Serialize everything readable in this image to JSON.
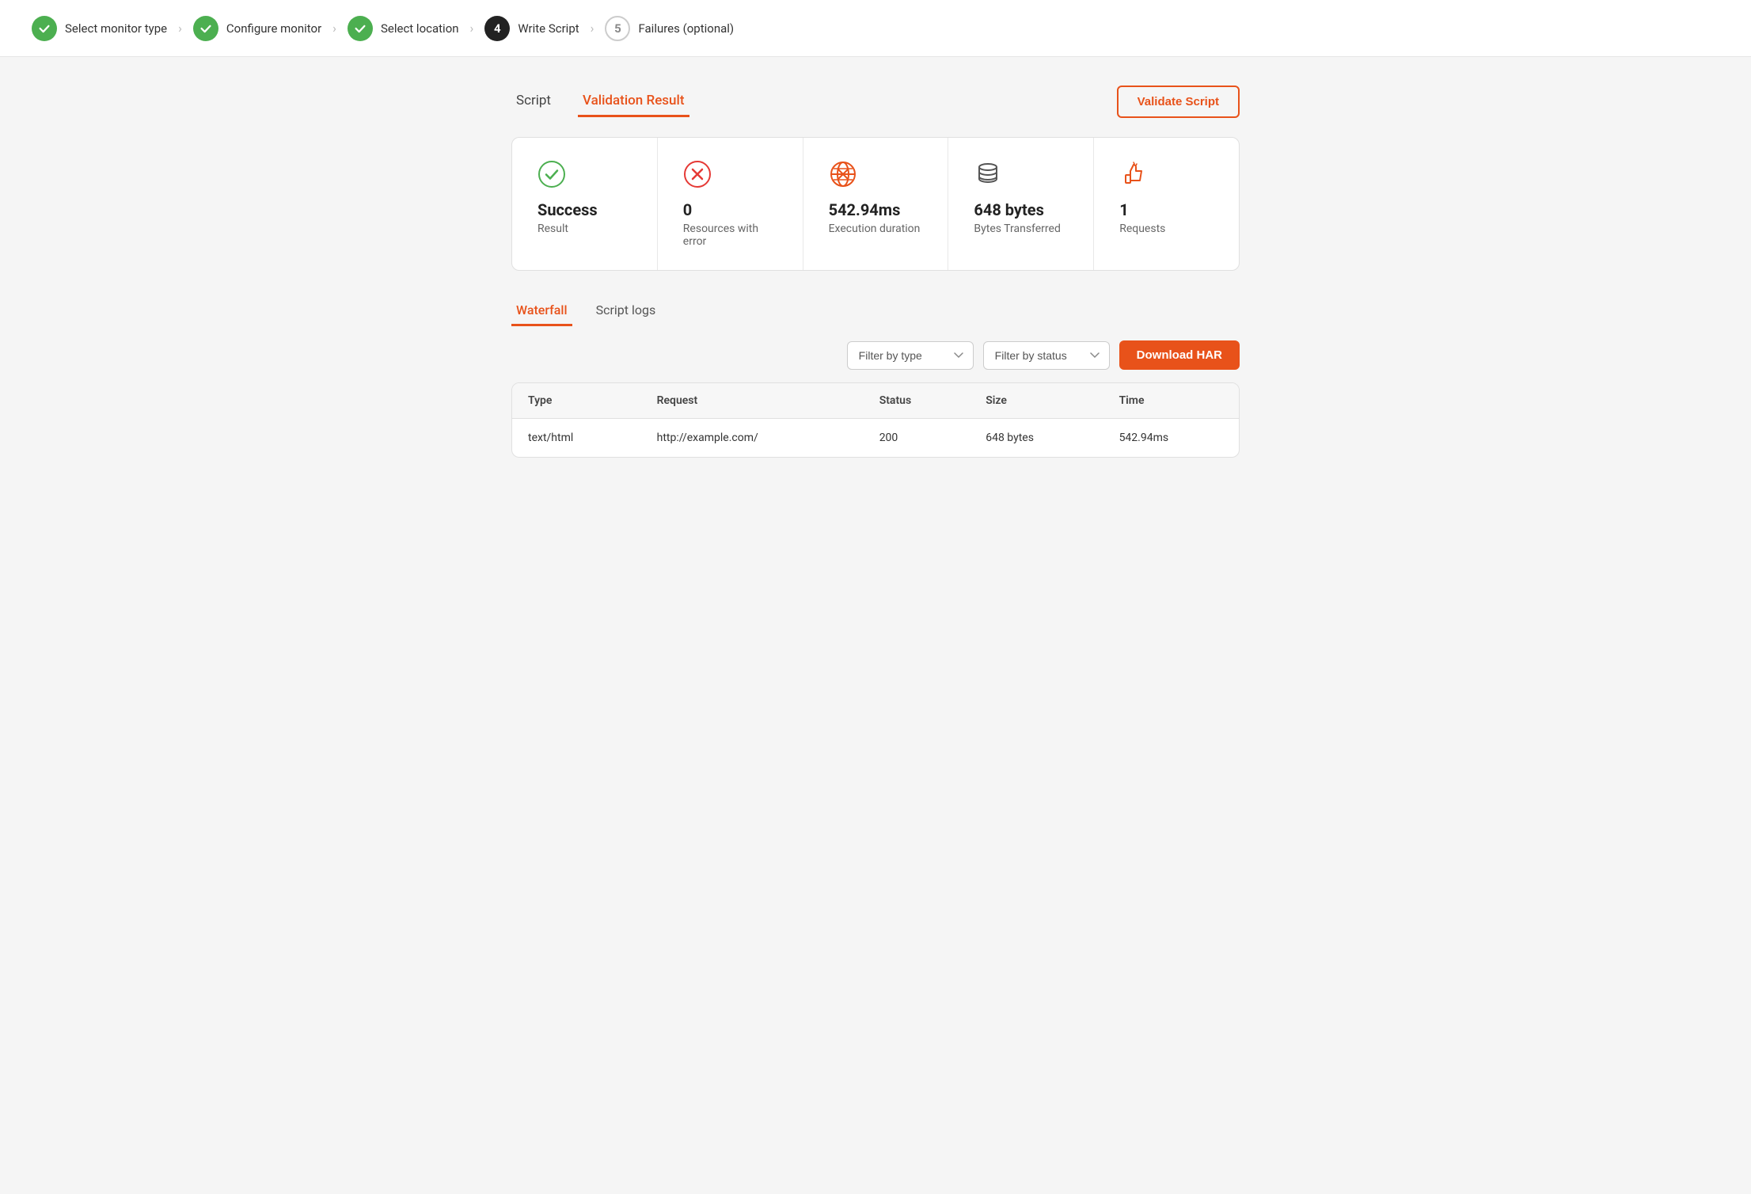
{
  "stepper": {
    "steps": [
      {
        "id": "select-monitor-type",
        "label": "Select monitor type",
        "state": "complete"
      },
      {
        "id": "configure-monitor",
        "label": "Configure monitor",
        "state": "complete"
      },
      {
        "id": "select-location",
        "label": "Select location",
        "state": "complete"
      },
      {
        "id": "write-script",
        "label": "Write Script",
        "state": "active",
        "number": "4"
      },
      {
        "id": "failures-optional",
        "label": "Failures (optional)",
        "state": "inactive",
        "number": "5"
      }
    ],
    "arrows": [
      ">",
      ">",
      ">",
      ">"
    ]
  },
  "tabs": {
    "script_label": "Script",
    "validation_result_label": "Validation Result",
    "validate_button_label": "Validate Script"
  },
  "metrics": [
    {
      "id": "result",
      "icon_name": "success-icon",
      "value": "Success",
      "label": "Result"
    },
    {
      "id": "resources-with-error",
      "icon_name": "error-icon",
      "value": "0",
      "label": "Resources with error"
    },
    {
      "id": "execution-duration",
      "icon_name": "globe-icon",
      "value": "542.94ms",
      "label": "Execution duration"
    },
    {
      "id": "bytes-transferred",
      "icon_name": "database-icon",
      "value": "648 bytes",
      "label": "Bytes Transferred"
    },
    {
      "id": "requests",
      "icon_name": "thumbsup-icon",
      "value": "1",
      "label": "Requests"
    }
  ],
  "waterfall": {
    "tabs": [
      {
        "label": "Waterfall",
        "active": true
      },
      {
        "label": "Script logs",
        "active": false
      }
    ],
    "filter_type_placeholder": "Filter by type",
    "filter_status_placeholder": "Filter by status",
    "download_har_label": "Download HAR",
    "table": {
      "columns": [
        "Type",
        "Request",
        "Status",
        "Size",
        "Time"
      ],
      "rows": [
        {
          "type": "text/html",
          "request": "http://example.com/",
          "status": "200",
          "size": "648 bytes",
          "time": "542.94ms"
        }
      ]
    }
  }
}
